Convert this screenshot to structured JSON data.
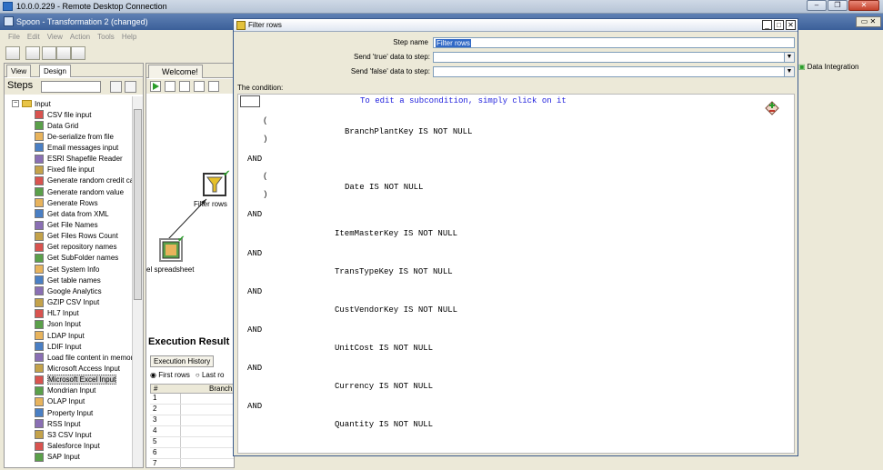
{
  "rdc": {
    "title": "10.0.0.229 - Remote Desktop Connection"
  },
  "spoon": {
    "title": "Spoon - Transformation 2 (changed)",
    "menu": [
      "File",
      "Edit",
      "View",
      "Action",
      "Tools",
      "Help"
    ],
    "perspective": "Data Integration"
  },
  "left_panel": {
    "tabs": [
      "View",
      "Design"
    ],
    "steps_label": "Steps",
    "category": "Input",
    "items": [
      "CSV file input",
      "Data Grid",
      "De-serialize from file",
      "Email messages input",
      "ESRI Shapefile Reader",
      "Fixed file input",
      "Generate random credit car",
      "Generate random value",
      "Generate Rows",
      "Get data from XML",
      "Get File Names",
      "Get Files Rows Count",
      "Get repository names",
      "Get SubFolder names",
      "Get System Info",
      "Get table names",
      "Google Analytics",
      "GZIP CSV Input",
      "HL7 Input",
      "Json Input",
      "LDAP Input",
      "LDIF Input",
      "Load file content in memory",
      "Microsoft Access Input",
      "Microsoft Excel Input",
      "Mondrian Input",
      "OLAP Input",
      "Property Input",
      "RSS Input",
      "S3 CSV Input",
      "Salesforce Input",
      "SAP Input"
    ],
    "selected_index": 24
  },
  "canvas": {
    "tab": "Welcome!",
    "nodes": {
      "filter_label": "Filter rows",
      "excel_label": "el spreadsheet"
    },
    "exec": {
      "title": "Execution Result",
      "tabs": [
        "Execution History"
      ],
      "radio_first": "First rows",
      "radio_last": "Last ro",
      "col_num": "#",
      "col_branch": "Branch",
      "rows": [
        "1",
        "2",
        "3",
        "4",
        "5",
        "6",
        "7"
      ]
    }
  },
  "dialog": {
    "title": "Filter rows",
    "step_name_label": "Step name",
    "step_name_value": "Filter rows",
    "send_true_label": "Send 'true' data to step:",
    "send_false_label": "Send 'false' data to step:",
    "condition_label": "The condition:",
    "hint": "To edit a subcondition, simply click on it",
    "and": "AND",
    "open_paren": "(",
    "close_paren": ")",
    "conditions": [
      "BranchPlantKey IS NOT NULL",
      "Date IS NOT NULL",
      "ItemMasterKey IS NOT NULL",
      "TransTypeKey IS NOT NULL",
      "CustVendorKey IS NOT NULL",
      "UnitCost IS NOT NULL",
      "Currency IS NOT NULL",
      "Quantity IS NOT NULL"
    ]
  },
  "colors": {
    "dialog_border": "#3a5a8c",
    "hint_text": "#2222dd",
    "selection": "#3169c6",
    "panel_bg": "#ece9d8"
  },
  "icons": [
    "monitor-icon",
    "spoon-icon",
    "folder-icon",
    "step-icon",
    "play-icon",
    "pause-icon",
    "stop-icon",
    "filter-icon",
    "spreadsheet-icon",
    "check-icon",
    "add-condition-icon"
  ]
}
